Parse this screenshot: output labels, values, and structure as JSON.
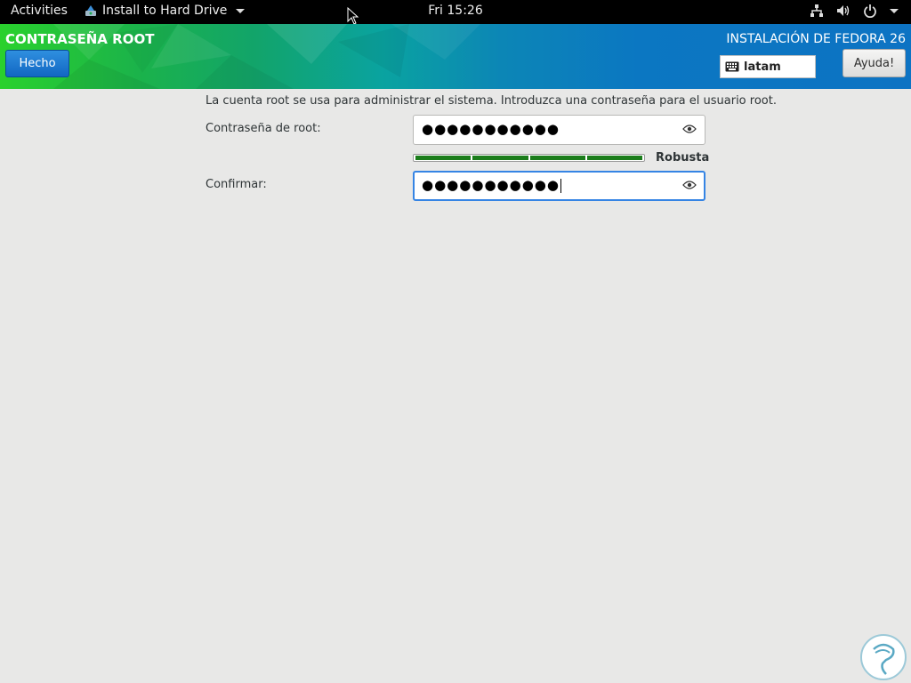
{
  "topbar": {
    "activities": "Activities",
    "app_name": "Install to Hard Drive",
    "clock": "Fri 15:26"
  },
  "header": {
    "title": "CONTRASEÑA ROOT",
    "done_label": "Hecho",
    "install_title": "INSTALACIÓN DE FEDORA 26",
    "keyboard_layout": "latam",
    "help_label": "Ayuda!"
  },
  "content": {
    "intro": "La cuenta root se usa para administrar el sistema. Introduzca una contraseña para el usuario root.",
    "password_label": "Contraseña de root:",
    "password_value": "●●●●●●●●●●●",
    "strength_label": "Robusta",
    "strength_level": 1.0,
    "confirm_label": "Confirmar:",
    "confirm_value": "●●●●●●●●●●●"
  },
  "colors": {
    "accent": "#1267c2",
    "strength_bar": "#1b7d1b",
    "focus_ring": "#3584e4"
  },
  "icons": [
    "app-installer-icon",
    "network-icon",
    "volume-icon",
    "power-icon",
    "keyboard-icon",
    "eye-icon"
  ]
}
